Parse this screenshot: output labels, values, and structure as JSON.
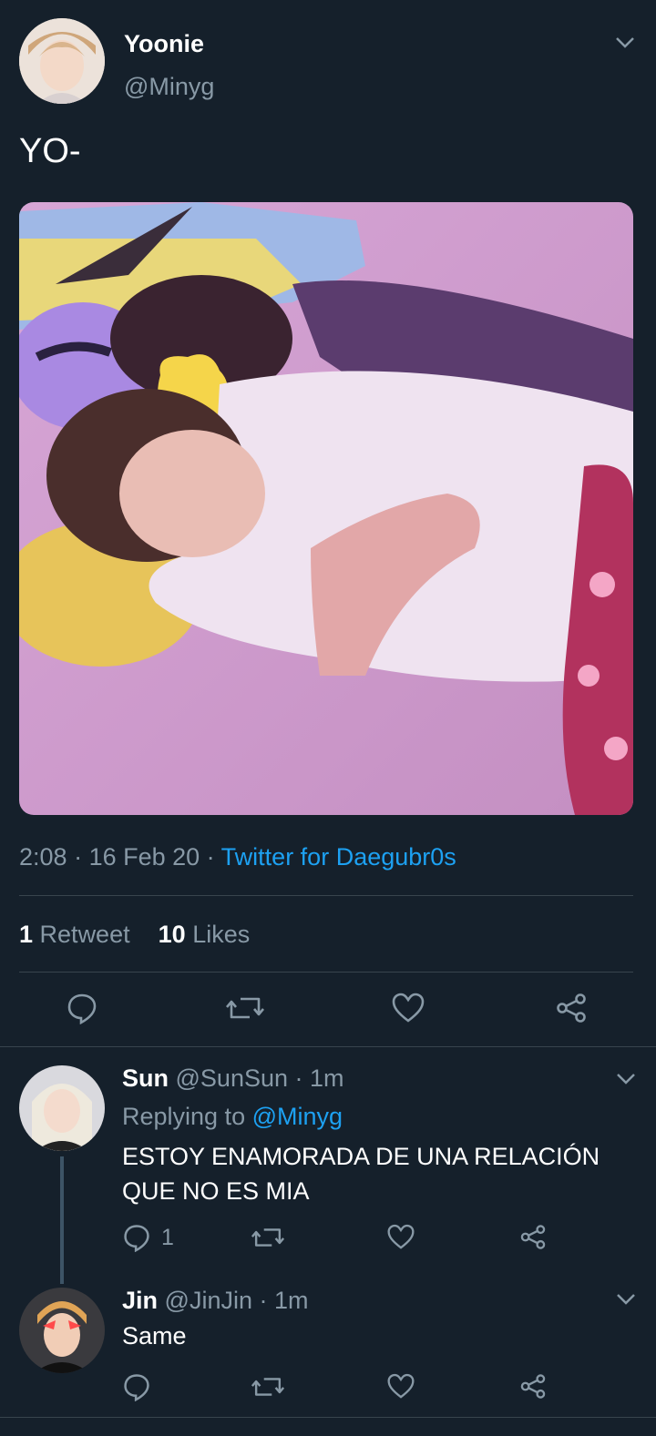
{
  "tweet": {
    "author": {
      "name": "Yoonie",
      "handle": "@Minyg"
    },
    "text": "YO-",
    "time": "2:08",
    "date": "16 Feb 20",
    "source": "Twitter for Daegubr0s",
    "retweet_count": "1",
    "retweet_label": "Retweet",
    "like_count": "10",
    "like_label": "Likes"
  },
  "replies": [
    {
      "name": "Sun",
      "handle": "@SunSun",
      "time": "1m",
      "replying_prefix": "Replying to",
      "replying_to": "@Minyg",
      "text": "ESTOY ENAMORADA DE UNA RELACIÓN QUE NO ES MIA",
      "reply_count": "1"
    },
    {
      "name": "Jin",
      "handle": "@JinJin",
      "time": "1m",
      "text": "Same"
    }
  ],
  "colors": {
    "background": "#15202b",
    "muted": "#8899a6",
    "link": "#1da1f2",
    "divider": "#38444d"
  }
}
